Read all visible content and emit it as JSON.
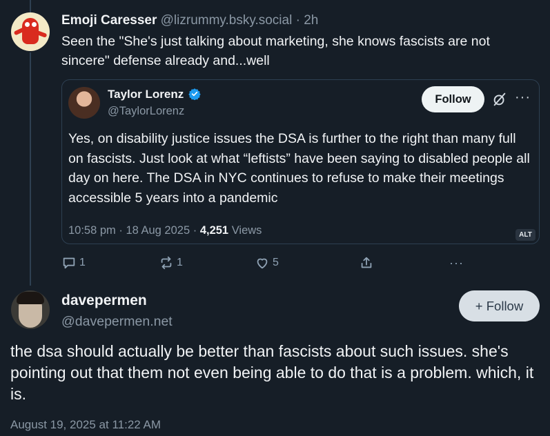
{
  "reply_post": {
    "author_name": "Emoji Caresser",
    "author_handle": "@lizrummy.bsky.social",
    "separator": "·",
    "time": "2h",
    "text": "Seen the \"She's just talking about marketing, she knows fascists are not sincere\" defense already and...well"
  },
  "quoted_post": {
    "author_name": "Taylor Lorenz",
    "author_handle": "@TaylorLorenz",
    "follow_label": "Follow",
    "more_label": "···",
    "text": "Yes, on disability justice issues the DSA is further to the right than many full on fascists. Just look at what “leftists” have been saying to disabled people all day on here. The DSA in NYC continues to refuse to make their meetings accessible 5 years into a pandemic",
    "timestamp": "10:58 pm · 18 Aug 2025 · ",
    "views_count": "4,251",
    "views_label": " Views",
    "alt_label": "ALT"
  },
  "reply_actions": {
    "reply_count": "1",
    "repost_count": "1",
    "like_count": "5",
    "more_label": "···"
  },
  "main_post": {
    "author_name": "davepermen",
    "author_handle": "@davepermen.net",
    "follow_label": "+ Follow",
    "text": "the dsa should actually be better than fascists about such issues. she's pointing out that them not even being able to do that is a problem. which, it is.",
    "date": "August 19, 2025 at 11:22 AM"
  },
  "colors": {
    "background": "#161e27",
    "muted_text": "#8b98a5",
    "verified": "#1d9bf0",
    "border": "#2e4052"
  },
  "icons": [
    "reply-icon",
    "repost-icon",
    "like-icon",
    "share-icon",
    "more-icon",
    "verified-icon",
    "grok-icon"
  ]
}
